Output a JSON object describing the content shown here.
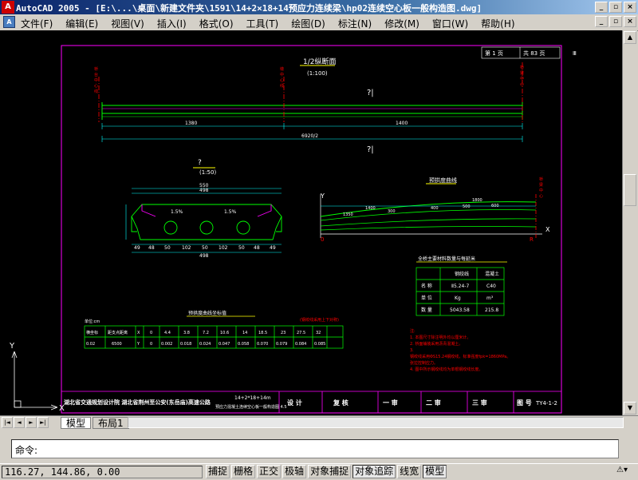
{
  "window": {
    "icon": "autocad-icon",
    "title": "AutoCAD 2005 - [E:\\...\\桌面\\新建文件夹\\1591\\14+2×18+14预应力连续梁\\hp02连续空心板一般构造图.dwg]"
  },
  "menubar": {
    "items": [
      "文件(F)",
      "编辑(E)",
      "视图(V)",
      "插入(I)",
      "格式(O)",
      "工具(T)",
      "绘图(D)",
      "标注(N)",
      "修改(M)",
      "窗口(W)",
      "帮助(H)"
    ]
  },
  "drawing": {
    "sheet_no": "第 1 页",
    "sheet_total": "共 83 页",
    "corner_mark": "Ⅲ",
    "half_elevation_title": "1/2纵断面",
    "half_elevation_scale": "(1:100)",
    "dim_left": "1380",
    "dim_right": "1400",
    "dim_total": "6920/2",
    "qmark_1": "?|",
    "qmark_2": "?|",
    "section_title": "?",
    "section_scale": "(1:50)",
    "section_dims_top": [
      "550",
      "498"
    ],
    "section_slope_left": "1.5%",
    "section_slope_right": "1.5%",
    "section_dims_bottom": [
      "49",
      "48",
      "50",
      "102",
      "50",
      "102",
      "50",
      "48",
      "49"
    ],
    "section_dim_total": "498",
    "camber_title": "预拱度曲线",
    "camber_axis_y": "Y",
    "camber_axis_x": "X",
    "camber_origin": "0",
    "camber_end": "R",
    "camber_labels": [
      "1400",
      "1800",
      "1350",
      "300",
      "400",
      "500",
      "600"
    ],
    "qty_table_title": "全桥主要材料数量与每延米",
    "qty_table": {
      "headers": [
        "",
        "钢绞线",
        "混凝土"
      ],
      "rows": [
        [
          "名 称",
          "Ⅱ5.24-7",
          "C40"
        ],
        [
          "单 位",
          "Kg",
          "m³"
        ],
        [
          "数 量",
          "5043.58",
          "215.8"
        ]
      ]
    },
    "coord_table_title": "预拱度曲线坐标值",
    "coord_note": "(钢绞线采用上下对称)",
    "coord_table_label": "单位:cm",
    "coord_table": {
      "row1": [
        "横坐标",
        "距支点距离",
        "X",
        "0",
        "4.4",
        "3.8",
        "7.2",
        "10.6",
        "14",
        "18.5",
        "23",
        "27.5",
        "32"
      ],
      "row2": [
        "0.02",
        "6500",
        "Y",
        "0",
        "0.002",
        "0.018",
        "0.024",
        "0.047",
        "0.058",
        "0.070",
        "0.079",
        "0.084",
        "0.085"
      ]
    },
    "notes_title": "注:",
    "notes": [
      "1. 本图尺寸除注明外均以厘米计。",
      "2. 桥面铺装采用沥青混凝土。",
      "3.",
      "   钢绞线采用ΦS15.24钢绞线，标准强度fpk=1860MPa。",
      "   张拉控制应力。",
      "4. 图中所示钢绞线均为单根钢绞线长度。"
    ],
    "titleblock": {
      "org": "湖北省交通规划设计院 湖北省荆州至公安(东岳庙)高速公路",
      "proj_line1": "14+2*18+14m",
      "proj_line2": "预应力混凝土连续空心板一般构造图 4.5",
      "cells": [
        "设 计",
        "复 核",
        "一 审",
        "二 审",
        "三 审",
        "图 号"
      ],
      "drawing_no": "TY4-1-2"
    },
    "ucs_labels": {
      "y": "Y",
      "x": "X"
    }
  },
  "tabs": {
    "nav": [
      "|◄",
      "◄",
      "►",
      "►|"
    ],
    "model": "模型",
    "layout": "布局1"
  },
  "command": {
    "prompt": "命令:"
  },
  "status": {
    "coords": "116.27, 144.86, 0.00",
    "toggles": [
      {
        "label": "捕捉",
        "on": false
      },
      {
        "label": "栅格",
        "on": false
      },
      {
        "label": "正交",
        "on": false
      },
      {
        "label": "极轴",
        "on": false
      },
      {
        "label": "对象捕捉",
        "on": false
      },
      {
        "label": "对象追踪",
        "on": true
      },
      {
        "label": "线宽",
        "on": false
      },
      {
        "label": "模型",
        "on": true
      }
    ]
  },
  "colors": {
    "frame": "#ff00ff",
    "linework": "#00ff00",
    "dimension": "#00ffff",
    "text": "#ffffff",
    "annotation_red": "#ff0000",
    "accent_yellow": "#ffff00"
  }
}
